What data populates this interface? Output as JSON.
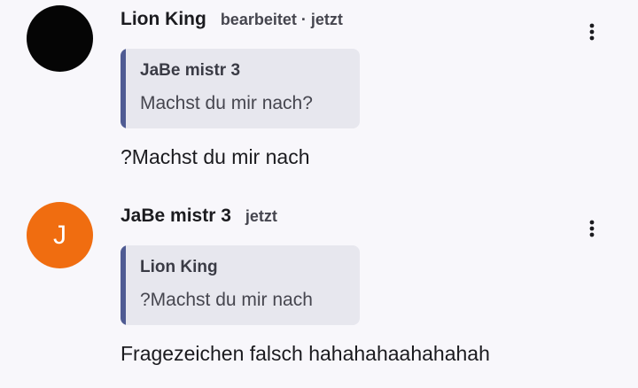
{
  "comments": [
    {
      "author": "Lion King",
      "edited": "bearbeitet",
      "separator": "·",
      "time": "jetzt",
      "avatar_letter": "",
      "avatar_color": "#050505",
      "quote": {
        "author": "JaBe mistr 3",
        "text": "Machst du mir nach?"
      },
      "text": "?Machst du mir nach",
      "more_icon": "more-vert-icon"
    },
    {
      "author": "JaBe mistr 3",
      "time": "jetzt",
      "avatar_letter": "J",
      "avatar_color": "#f06d10",
      "quote": {
        "author": "Lion King",
        "text": "?Machst du mir nach"
      },
      "text": "Fragezeichen falsch hahahahaahahahah",
      "more_icon": "more-vert-icon"
    }
  ],
  "colors": {
    "background": "#f8f7fb",
    "quote_background": "#e7e7ee",
    "quote_accent": "#4f5b93"
  }
}
